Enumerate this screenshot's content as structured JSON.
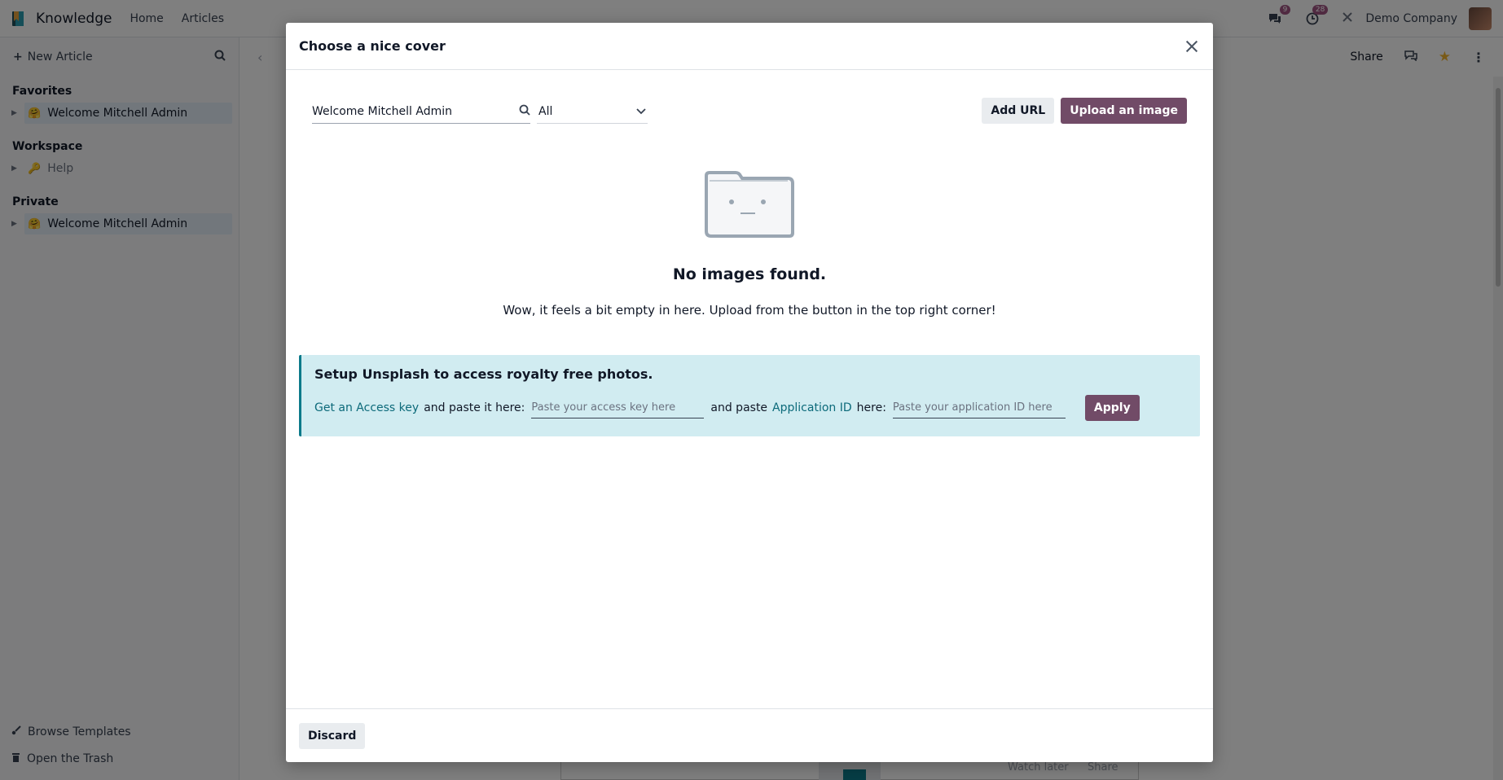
{
  "navbar": {
    "app_name": "Knowledge",
    "home": "Home",
    "articles": "Articles",
    "messages_count": "9",
    "activities_count": "28",
    "company": "Demo Company"
  },
  "sidebar": {
    "new_article": "New Article",
    "sections": {
      "favorites": "Favorites",
      "workspace": "Workspace",
      "private": "Private"
    },
    "favorites_items": [
      {
        "label": "Welcome Mitchell Admin"
      }
    ],
    "workspace_items": [
      {
        "label": "Help"
      }
    ],
    "private_items": [
      {
        "label": "Welcome Mitchell Admin"
      }
    ],
    "browse_templates": "Browse Templates",
    "open_trash": "Open the Trash"
  },
  "content": {
    "share": "Share",
    "bg_watch_later": "Watch later",
    "bg_share": "Share"
  },
  "modal": {
    "title": "Choose a nice cover",
    "search_value": "Welcome Mitchell Admin",
    "filter_selected": "All",
    "add_url": "Add URL",
    "upload_image": "Upload an image",
    "empty_title": "No images found.",
    "empty_subtitle": "Wow, it feels a bit empty in here. Upload from the button in the top right corner!",
    "unsplash": {
      "title": "Setup Unsplash to access royalty free photos.",
      "get_key_link": "Get an Access key",
      "paste_here": "and paste it here:",
      "key_placeholder": "Paste your access key here",
      "and_paste": "and paste",
      "app_id_link": "Application ID",
      "here": "here:",
      "app_id_placeholder": "Paste your application ID here",
      "apply": "Apply"
    },
    "discard": "Discard"
  },
  "colors": {
    "primary": "#714b67",
    "info_bg": "#d1ecf1",
    "link": "#0c6a7a"
  }
}
